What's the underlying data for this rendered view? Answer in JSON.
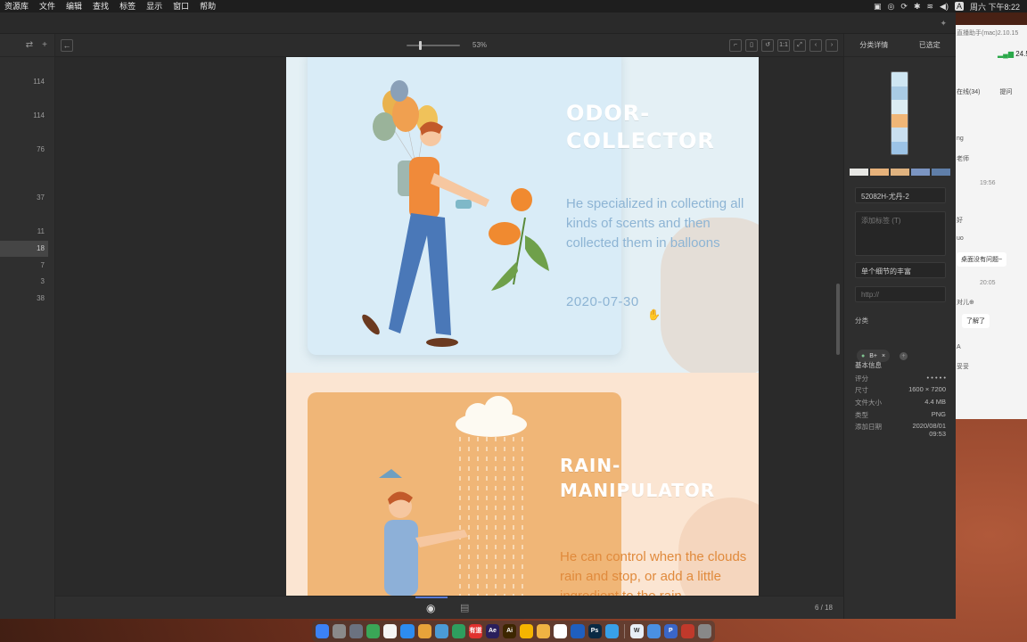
{
  "menubar": {
    "items": [
      "资源库",
      "文件",
      "编辑",
      "查找",
      "标签",
      "显示",
      "窗口",
      "帮助"
    ],
    "input_label": "A",
    "clock": "周六 下午8:22"
  },
  "chat": {
    "title": "直播助手(mac)2.10.15",
    "signal": "24.5",
    "tab_online": "在线(34)",
    "tab_ask": "提问",
    "lines": [
      "ng",
      "老师"
    ],
    "time1": "19:56",
    "lines2": [
      "好",
      "uo"
    ],
    "bubble1": "桌面没有问题~",
    "time2": "20:05",
    "line3": "对儿⊕",
    "bubble2": "了解了",
    "line4": "A",
    "line5": "妥妥"
  },
  "left": {
    "counts": [
      "114",
      "114",
      "76",
      "37",
      "11",
      "18",
      "7",
      "3",
      "38"
    ]
  },
  "toolbar": {
    "zoom": "53%",
    "buttons": [
      "⌐",
      "▯",
      "↺",
      "1:1",
      "⤢",
      "‹",
      "›"
    ]
  },
  "canvas": {
    "card1": {
      "title_line1": "ODOR-",
      "title_line2": "COLLECTOR",
      "desc": "He specialized in collecting all kinds of scents and then collected them in balloons",
      "date": "2020-07-30",
      "accent": "#8db4d4"
    },
    "card2": {
      "title_line1": "RAIN-",
      "title_line2": "MANIPULATOR",
      "desc": "He can control when the clouds rain and stop, or add a little ingredient to the rain",
      "accent": "#e08a3c"
    }
  },
  "status": {
    "page": "6 / 18"
  },
  "right": {
    "tab_details": "分类详情",
    "tab_selected": "已选定",
    "palette": [
      "#e7e7e4",
      "#e6b27b",
      "#dfb27f",
      "#7b95c2",
      "#5f7ea8"
    ],
    "filename": "52082H-尤丹-2",
    "tags_placeholder": "添加标签 (T)",
    "note": "单个细节的丰富",
    "url_placeholder": "http://",
    "category_label": "分类",
    "category_tag": "B+",
    "basic_info_label": "基本信息",
    "info": [
      {
        "k": "评分",
        "v": "• • • • •"
      },
      {
        "k": "尺寸",
        "v": "1600 × 7200"
      },
      {
        "k": "文件大小",
        "v": "4.4 MB"
      },
      {
        "k": "类型",
        "v": "PNG"
      },
      {
        "k": "添加日期",
        "v": "2020/08/01 09:53"
      }
    ]
  },
  "dock": {
    "icons": [
      {
        "label": "",
        "color": "#3b82f6"
      },
      {
        "label": "",
        "color": "#8a8a8a"
      },
      {
        "label": "",
        "color": "#6b7280"
      },
      {
        "label": "",
        "color": "#3aa657"
      },
      {
        "label": "",
        "color": "#f5f5f5"
      },
      {
        "label": "",
        "color": "#2d8cf0"
      },
      {
        "label": "",
        "color": "#e8a33a"
      },
      {
        "label": "",
        "color": "#4b9bd6"
      },
      {
        "label": "",
        "color": "#2e9e5e"
      },
      {
        "label": "有道",
        "color": "#e0312f"
      },
      {
        "label": "Ae",
        "color": "#2a1f5c"
      },
      {
        "label": "Ai",
        "color": "#3d2600"
      },
      {
        "label": "",
        "color": "#f4b400"
      },
      {
        "label": "",
        "color": "#f0b343"
      },
      {
        "label": "",
        "color": "#ffffff"
      },
      {
        "label": "",
        "color": "#1f5fbf"
      },
      {
        "label": "Ps",
        "color": "#0a2a44"
      },
      {
        "label": "",
        "color": "#38a0e8"
      },
      {
        "label": "W",
        "color": "#e8eef6"
      },
      {
        "label": "",
        "color": "#4a90e2"
      },
      {
        "label": "P",
        "color": "#3a66c8"
      },
      {
        "label": "",
        "color": "#c0392b"
      },
      {
        "label": "",
        "color": "#888888"
      }
    ]
  }
}
